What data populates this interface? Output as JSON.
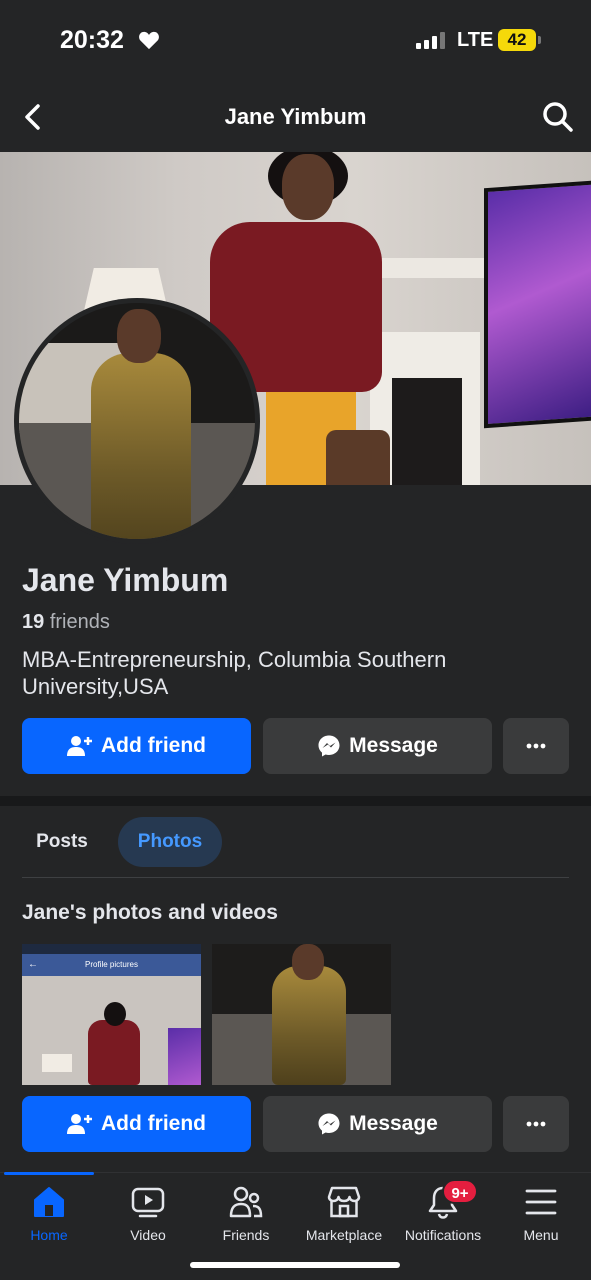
{
  "status_bar": {
    "time": "20:32",
    "network": "LTE",
    "battery": "42"
  },
  "header": {
    "title": "Jane Yimbum"
  },
  "profile": {
    "name": "Jane Yimbum",
    "friends_count": "19",
    "friends_label": "friends",
    "bio": "MBA-Entrepreneurship, Columbia Southern University,USA"
  },
  "actions": {
    "add_friend": "Add friend",
    "message": "Message"
  },
  "tabs": [
    {
      "label": "Posts",
      "active": false
    },
    {
      "label": "Photos",
      "active": true
    }
  ],
  "photos_section": {
    "title": "Jane's photos and videos",
    "thumb1_caption": "Profile pictures"
  },
  "bottom_nav": {
    "items": [
      {
        "label": "Home",
        "icon": "home-icon",
        "active": true
      },
      {
        "label": "Video",
        "icon": "video-icon"
      },
      {
        "label": "Friends",
        "icon": "friends-icon"
      },
      {
        "label": "Marketplace",
        "icon": "marketplace-icon"
      },
      {
        "label": "Notifications",
        "icon": "bell-icon",
        "badge": "9+"
      },
      {
        "label": "Menu",
        "icon": "menu-icon"
      }
    ]
  },
  "colors": {
    "background": "#242526",
    "accent": "#0866ff",
    "secondary_button": "#3a3b3c",
    "badge": "#e41e3f"
  }
}
